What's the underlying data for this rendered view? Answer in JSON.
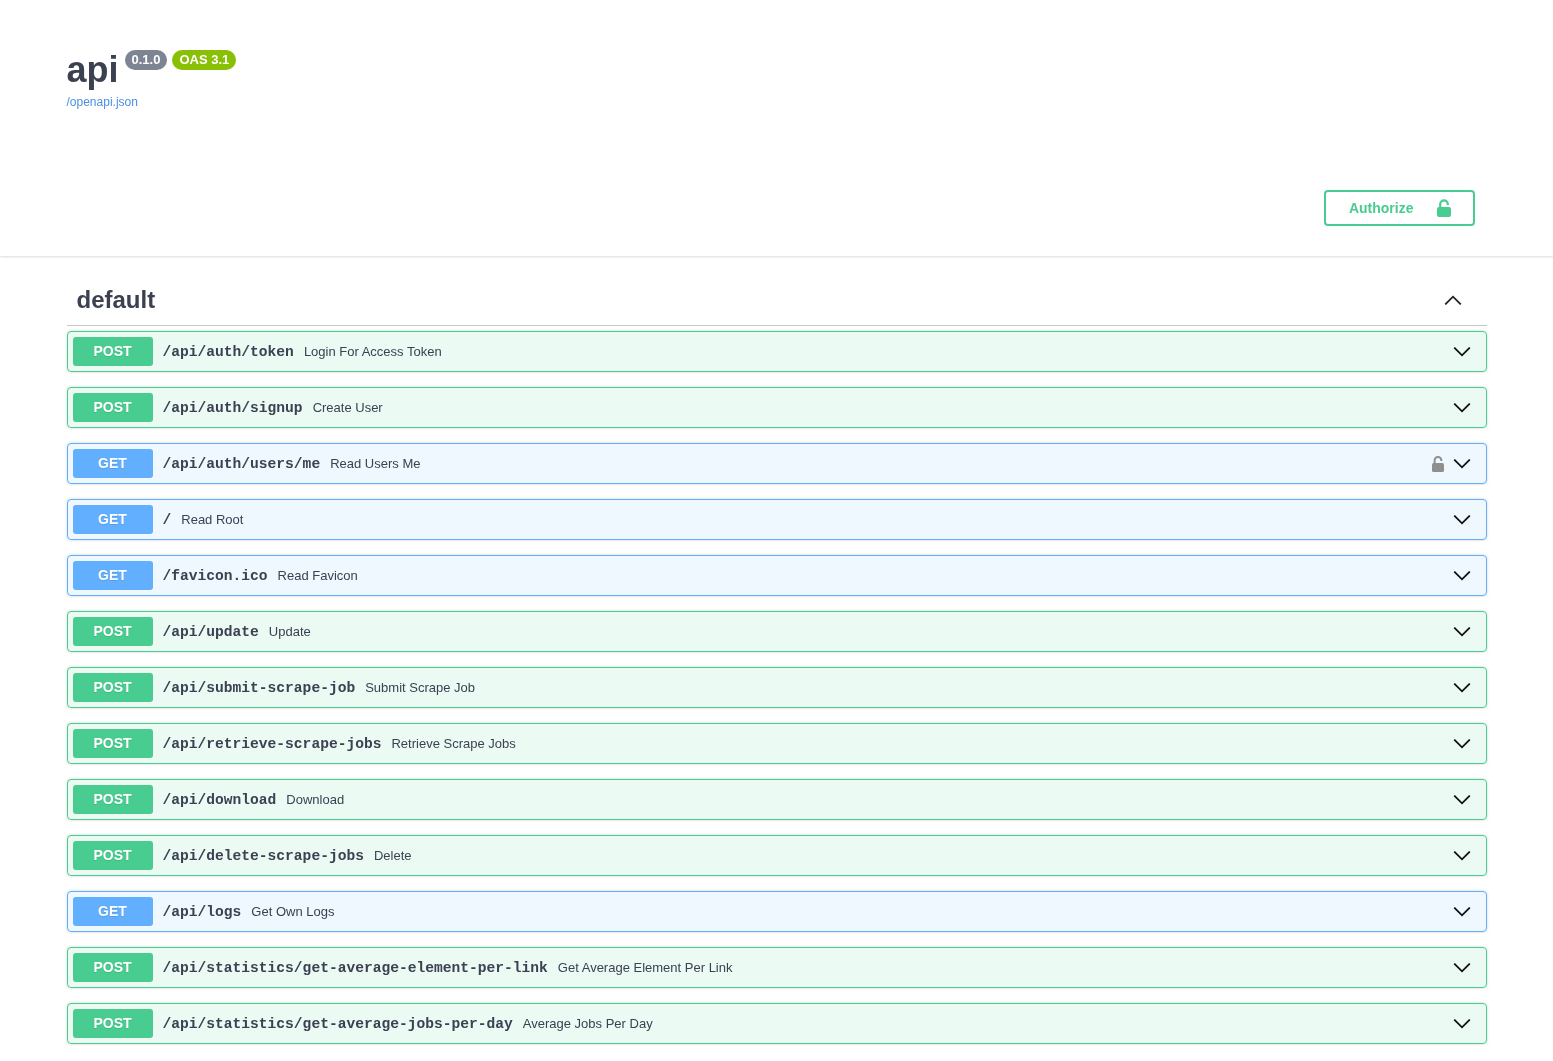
{
  "info": {
    "title": "api",
    "version": "0.1.0",
    "oas": "OAS 3.1",
    "spec_link": "/openapi.json"
  },
  "authorize": {
    "label": "Authorize"
  },
  "section": {
    "title": "default",
    "expanded": true,
    "operations": [
      {
        "method": "POST",
        "color": "#49cc90",
        "path": "/api/auth/token",
        "summary": "Login For Access Token",
        "auth_required": false,
        "expanded": false
      },
      {
        "method": "POST",
        "color": "#49cc90",
        "path": "/api/auth/signup",
        "summary": "Create User",
        "auth_required": false,
        "expanded": false
      },
      {
        "method": "GET",
        "color": "#61affe",
        "path": "/api/auth/users/me",
        "summary": "Read Users Me",
        "auth_required": true,
        "expanded": false
      },
      {
        "method": "GET",
        "color": "#61affe",
        "path": "/",
        "summary": "Read Root",
        "auth_required": false,
        "expanded": false
      },
      {
        "method": "GET",
        "color": "#61affe",
        "path": "/favicon.ico",
        "summary": "Read Favicon",
        "auth_required": false,
        "expanded": false
      },
      {
        "method": "POST",
        "color": "#49cc90",
        "path": "/api/update",
        "summary": "Update",
        "auth_required": false,
        "expanded": false
      },
      {
        "method": "POST",
        "color": "#49cc90",
        "path": "/api/submit-scrape-job",
        "summary": "Submit Scrape Job",
        "auth_required": false,
        "expanded": false
      },
      {
        "method": "POST",
        "color": "#49cc90",
        "path": "/api/retrieve-scrape-jobs",
        "summary": "Retrieve Scrape Jobs",
        "auth_required": false,
        "expanded": false
      },
      {
        "method": "POST",
        "color": "#49cc90",
        "path": "/api/download",
        "summary": "Download",
        "auth_required": false,
        "expanded": false
      },
      {
        "method": "POST",
        "color": "#49cc90",
        "path": "/api/delete-scrape-jobs",
        "summary": "Delete",
        "auth_required": false,
        "expanded": false
      },
      {
        "method": "GET",
        "color": "#61affe",
        "path": "/api/logs",
        "summary": "Get Own Logs",
        "auth_required": false,
        "expanded": false
      },
      {
        "method": "POST",
        "color": "#49cc90",
        "path": "/api/statistics/get-average-element-per-link",
        "summary": "Get Average Element Per Link",
        "auth_required": false,
        "expanded": false
      },
      {
        "method": "POST",
        "color": "#49cc90",
        "path": "/api/statistics/get-average-jobs-per-day",
        "summary": "Average Jobs Per Day",
        "auth_required": false,
        "expanded": false
      }
    ]
  }
}
